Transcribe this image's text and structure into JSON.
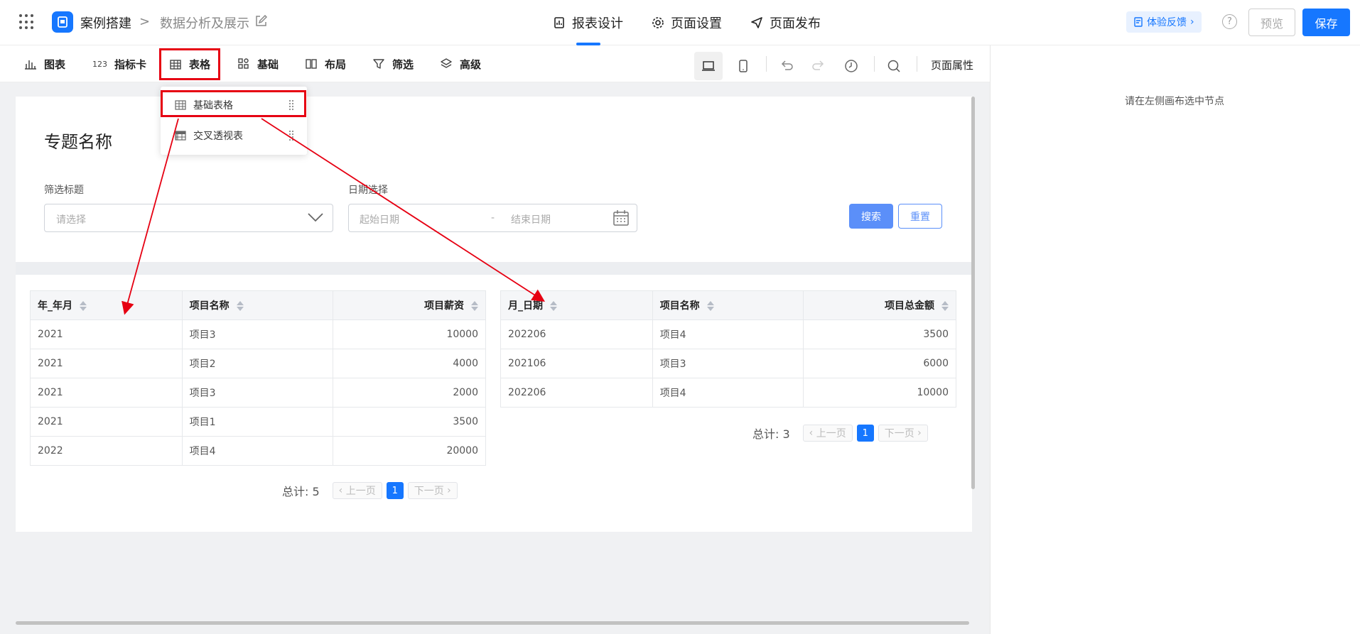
{
  "header": {
    "app_name": "案例搭建",
    "separator": ">",
    "page_name": "数据分析及展示",
    "tabs": [
      {
        "label": "报表设计",
        "icon": "report-icon",
        "active": true
      },
      {
        "label": "页面设置",
        "icon": "gear-icon",
        "active": false
      },
      {
        "label": "页面发布",
        "icon": "send-icon",
        "active": false
      }
    ],
    "feedback_label": "体验反馈",
    "help_symbol": "?",
    "preview_label": "预览",
    "save_label": "保存",
    "accent_color": "#1677ff"
  },
  "toolbar": {
    "items": [
      {
        "label": "图表",
        "icon": "bar-chart-icon"
      },
      {
        "label": "指标卡",
        "icon": "number-icon",
        "icon_text": "123"
      },
      {
        "label": "表格",
        "icon": "table-icon"
      },
      {
        "label": "基础",
        "icon": "grid-icon"
      },
      {
        "label": "布局",
        "icon": "layout-icon"
      },
      {
        "label": "筛选",
        "icon": "filter-icon"
      },
      {
        "label": "高级",
        "icon": "layers-icon"
      }
    ],
    "page_props_label": "页面属性"
  },
  "dropdown": {
    "items": [
      {
        "label": "基础表格",
        "icon": "table-icon"
      },
      {
        "label": "交叉透视表",
        "icon": "pivot-table-icon"
      }
    ]
  },
  "canvas": {
    "topic_title": "专题名称",
    "filter_label": "筛选标题",
    "filter_placeholder": "请选择",
    "date_label": "日期选择",
    "date_start_placeholder": "起始日期",
    "date_separator": "-",
    "date_end_placeholder": "结束日期",
    "search_label": "搜索",
    "reset_label": "重置"
  },
  "table1": {
    "headers": [
      "年_年月",
      "项目名称",
      "项目薪资"
    ],
    "rows": [
      [
        "2021",
        "项目3",
        "10000"
      ],
      [
        "2021",
        "项目2",
        "4000"
      ],
      [
        "2021",
        "项目3",
        "2000"
      ],
      [
        "2021",
        "项目1",
        "3500"
      ],
      [
        "2022",
        "项目4",
        "20000"
      ]
    ],
    "total_label": "总计: 5",
    "prev_label": "上一页",
    "next_label": "下一页",
    "page": "1"
  },
  "table2": {
    "headers": [
      "月_日期",
      "项目名称",
      "项目总金额"
    ],
    "rows": [
      [
        "202206",
        "项目4",
        "3500"
      ],
      [
        "202106",
        "项目3",
        "6000"
      ],
      [
        "202206",
        "项目4",
        "10000"
      ]
    ],
    "total_label": "总计: 3",
    "prev_label": "上一页",
    "next_label": "下一页",
    "page": "1"
  },
  "right_panel": {
    "hint": "请在左侧画布选中节点"
  }
}
